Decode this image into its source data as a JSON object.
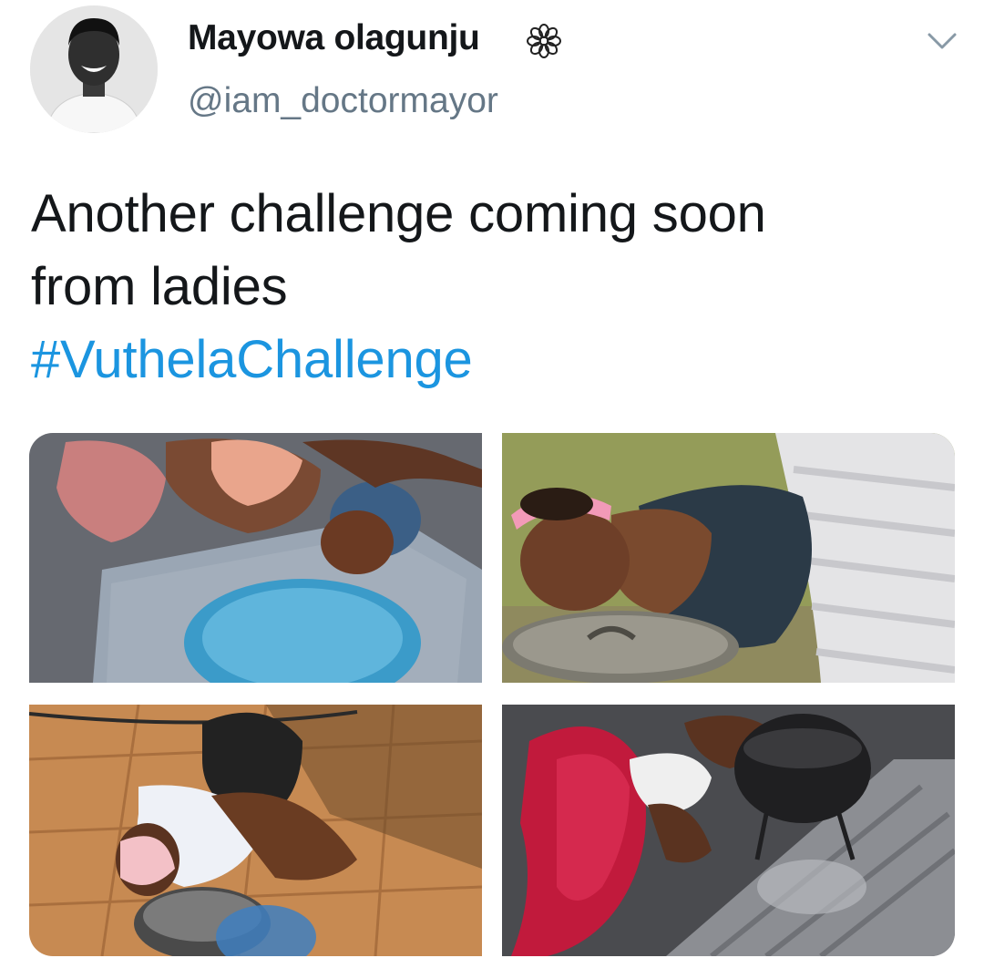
{
  "tweet": {
    "author": {
      "display_name": "Mayowa olagunju",
      "handle": "@iam_doctormayor",
      "badge_icon": "flower-emoji-icon",
      "avatar_icon": "profile-photo"
    },
    "menu_icon": "chevron-down-icon",
    "text_lines": [
      "Another challenge coming soon",
      "from ladies"
    ],
    "hashtag": "#VuthelaChallenge",
    "media": [
      {
        "icon": "photo-woman-tasting-pot-lid-on-metal-sheet"
      },
      {
        "icon": "photo-woman-in-pink-headband-over-pot-lid-on-grass"
      },
      {
        "icon": "photo-woman-bending-over-pot-on-tiles"
      },
      {
        "icon": "photo-woman-in-red-leggings-over-pot-on-ashes"
      }
    ]
  },
  "colors": {
    "text": "#14171a",
    "secondary_text": "#657786",
    "hashtag": "#1b95e0",
    "background": "#ffffff"
  }
}
